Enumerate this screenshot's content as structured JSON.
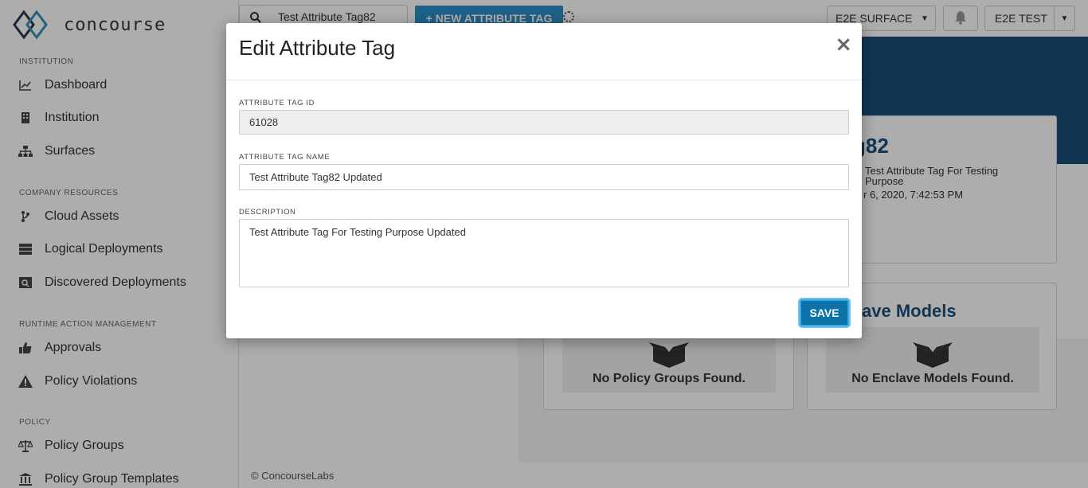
{
  "app": {
    "logo_text": "concourse"
  },
  "sidebar": {
    "sections": [
      {
        "label": "INSTITUTION",
        "items": [
          {
            "label": "Dashboard",
            "icon": "chart-icon"
          },
          {
            "label": "Institution",
            "icon": "building-icon"
          },
          {
            "label": "Surfaces",
            "icon": "sitemap-icon"
          }
        ]
      },
      {
        "label": "COMPANY RESOURCES",
        "items": [
          {
            "label": "Cloud Assets",
            "icon": "branch-icon"
          },
          {
            "label": "Logical Deployments",
            "icon": "server-icon"
          },
          {
            "label": "Discovered Deployments",
            "icon": "search-server-icon"
          }
        ]
      },
      {
        "label": "RUNTIME ACTION MANAGEMENT",
        "items": [
          {
            "label": "Approvals",
            "icon": "thumbs-up-icon"
          },
          {
            "label": "Policy Violations",
            "icon": "warning-icon"
          }
        ]
      },
      {
        "label": "POLICY",
        "items": [
          {
            "label": "Policy Groups",
            "icon": "scale-icon"
          },
          {
            "label": "Policy Group Templates",
            "icon": "bank-icon"
          }
        ]
      }
    ]
  },
  "topbar": {
    "search_value": "Test Attribute Tag82",
    "new_button_label": "NEW ATTRIBUTE TAG",
    "surface_dropdown": "E2E SURFACE",
    "user_dropdown": "E2E TEST"
  },
  "background": {
    "title_fragment": "g82",
    "description_fragment": "Test Attribute Tag For Testing",
    "description_fragment_2": "Purpose",
    "date_fragment": "r 6, 2020, 7:42:53 PM",
    "enclave_title_fragment": "ave Models",
    "policy_groups_empty": "No Policy Groups Found.",
    "enclave_models_empty": "No Enclave Models Found."
  },
  "footer": {
    "text": "© ConcourseLabs"
  },
  "modal": {
    "title": "Edit Attribute Tag",
    "close_label": "×",
    "id_label": "ATTRIBUTE TAG ID",
    "id_value": "61028",
    "name_label": "ATTRIBUTE TAG NAME",
    "name_value": "Test Attribute Tag82 Updated",
    "description_label": "DESCRIPTION",
    "description_value": "Test Attribute Tag For Testing Purpose Updated",
    "save_label": "SAVE"
  },
  "colors": {
    "brand_blue": "#1d4f7c",
    "primary_button": "#0b73a8",
    "new_button": "#2c8fc9"
  }
}
